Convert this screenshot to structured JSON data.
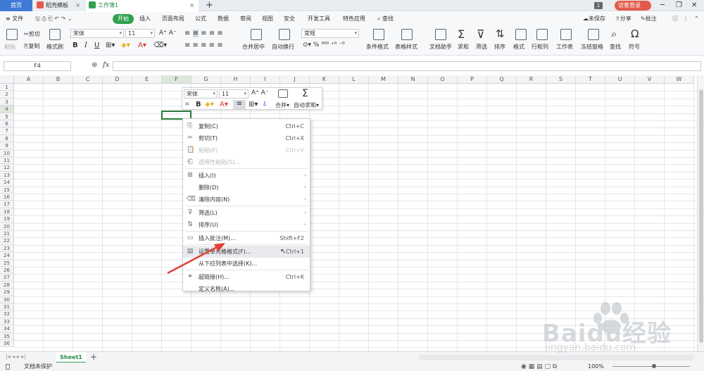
{
  "tabs": [
    {
      "label": "首页"
    },
    {
      "label": "稻壳模板"
    },
    {
      "label": "工作簿1"
    }
  ],
  "tab_badge": "1",
  "visitor_label": "访客登录",
  "menu": {
    "file": "文件",
    "start": "开始",
    "items": [
      "插入",
      "页面布局",
      "公式",
      "数据",
      "审阅",
      "视图",
      "安全",
      "开发工具",
      "特色应用"
    ],
    "search": "查找",
    "unsaved": "未保存",
    "share": "分享",
    "comment": "批注"
  },
  "ribbon": {
    "paste": "粘贴",
    "cut": "剪切",
    "copy": "复制",
    "format_painter": "格式刷",
    "font": "宋体",
    "size": "11",
    "merge": "合并居中",
    "wrap": "自动换行",
    "number_format": "常规",
    "cond_format": "条件格式",
    "table_style": "表格样式",
    "doc_helper": "文档助手",
    "sum": "求和",
    "filter": "筛选",
    "sort": "排序",
    "format": "格式",
    "rowcol": "行和列",
    "sheet": "工作表",
    "freeze": "冻结窗格",
    "find": "查找",
    "symbol": "符号"
  },
  "formula_bar": {
    "cell_ref": "F4",
    "fx": "fx"
  },
  "columns": [
    "A",
    "B",
    "C",
    "D",
    "E",
    "F",
    "G",
    "H",
    "I",
    "J",
    "K",
    "L",
    "M",
    "N",
    "O",
    "P",
    "Q",
    "R",
    "S",
    "T",
    "U",
    "V",
    "W"
  ],
  "rows": [
    "1",
    "2",
    "3",
    "4",
    "5",
    "6",
    "7",
    "8",
    "9",
    "10",
    "11",
    "12",
    "13",
    "14",
    "15",
    "16",
    "17",
    "18",
    "19",
    "20",
    "21",
    "22",
    "23",
    "24",
    "25",
    "26",
    "27",
    "28",
    "29",
    "30",
    "31",
    "32",
    "33",
    "34",
    "35",
    "36"
  ],
  "mini_toolbar": {
    "font": "宋体",
    "size": "11",
    "merge": "合并",
    "autosum": "自动求和"
  },
  "context_menu": [
    {
      "label": "复制(C)",
      "shortcut": "Ctrl+C",
      "icon": "copy-icon"
    },
    {
      "label": "剪切(T)",
      "shortcut": "Ctrl+X",
      "icon": "cut-icon"
    },
    {
      "label": "粘贴(P)",
      "shortcut": "Ctrl+V",
      "icon": "paste-icon",
      "disabled": true
    },
    {
      "label": "选择性粘贴(S)...",
      "shortcut": "",
      "icon": "paste-special-icon",
      "disabled": true
    },
    {
      "label": "插入(I)",
      "shortcut": "",
      "icon": "insert-icon",
      "submenu": true
    },
    {
      "label": "删除(D)",
      "shortcut": "",
      "icon": "",
      "submenu": true
    },
    {
      "label": "清除内容(N)",
      "shortcut": "",
      "icon": "clear-icon",
      "submenu": true
    },
    {
      "label": "筛选(L)",
      "shortcut": "",
      "icon": "filter-icon",
      "submenu": true
    },
    {
      "label": "排序(U)",
      "shortcut": "",
      "icon": "sort-icon",
      "submenu": true
    },
    {
      "label": "插入批注(M)...",
      "shortcut": "Shift+F2",
      "icon": "comment-icon"
    },
    {
      "label": "设置单元格格式(F)...",
      "shortcut": "Ctrl+1",
      "icon": "format-cells-icon",
      "highlighted": true
    },
    {
      "label": "从下拉列表中选择(K)...",
      "shortcut": "",
      "icon": ""
    },
    {
      "label": "超链接(H)...",
      "shortcut": "Ctrl+K",
      "icon": "link-icon"
    },
    {
      "label": "定义名称(A)...",
      "shortcut": "",
      "icon": ""
    }
  ],
  "sheet_tab": "Sheet1",
  "status": {
    "protect": "文档未保护",
    "zoom": "100%"
  },
  "watermark": {
    "brand": "Baidu经验",
    "url": "jingyan.baidu.com"
  },
  "colors": {
    "accent": "#2fa14f",
    "home_tab": "#3f7ad6",
    "arrow": "#e2413a"
  }
}
